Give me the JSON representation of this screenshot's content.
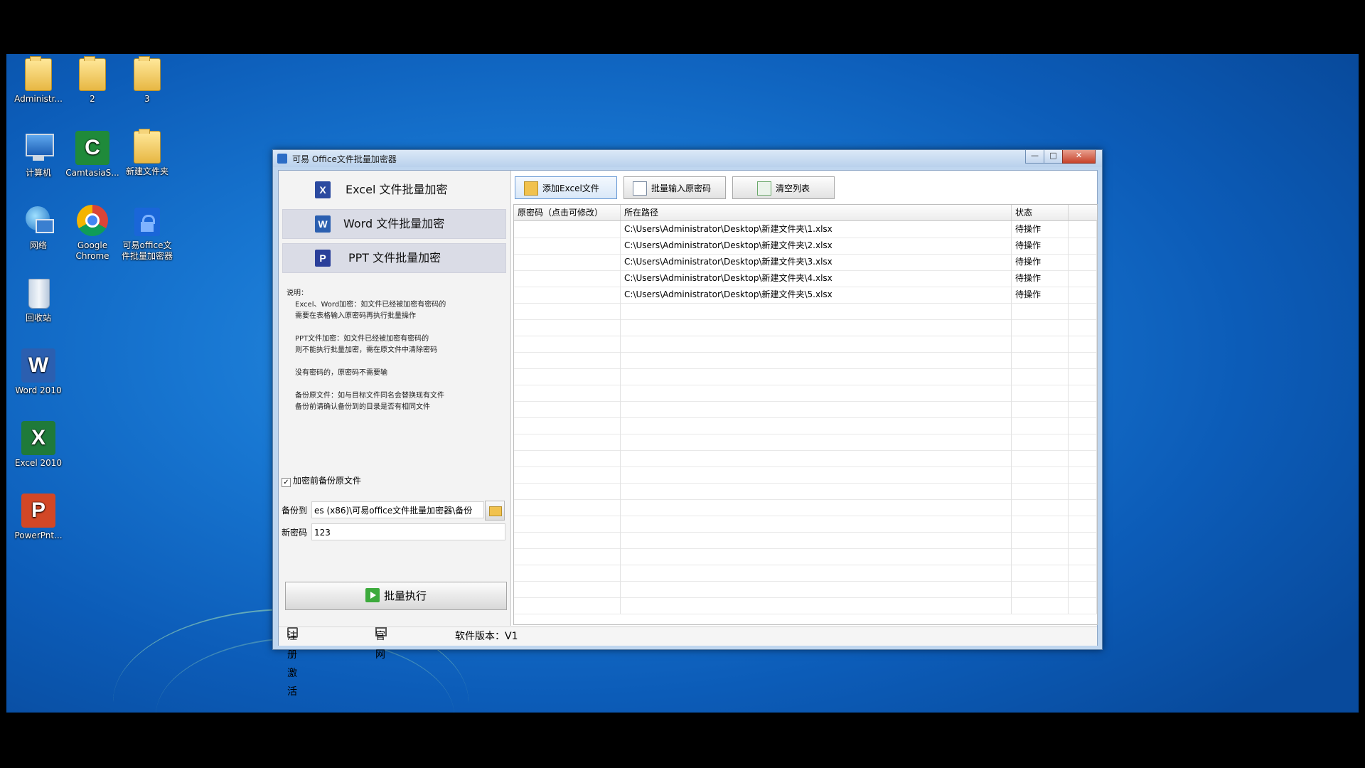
{
  "desktop": {
    "icons": [
      {
        "label": "Administr...",
        "icon": "user-folder-icon"
      },
      {
        "label": "2",
        "icon": "folder-icon"
      },
      {
        "label": "3",
        "icon": "folder-icon"
      },
      {
        "label": "计算机",
        "icon": "computer-icon"
      },
      {
        "label": "CamtasiaS...",
        "icon": "camtasia-icon"
      },
      {
        "label": "新建文件夹",
        "icon": "folder-icon"
      },
      {
        "label": "网络",
        "icon": "network-icon"
      },
      {
        "label": "Google Chrome",
        "icon": "chrome-icon"
      },
      {
        "label": "可易office文件批量加密器",
        "icon": "lock-app-icon"
      },
      {
        "label": "回收站",
        "icon": "recycle-bin-icon"
      },
      {
        "label": "Word 2010",
        "icon": "word-icon"
      },
      {
        "label": "Excel 2010",
        "icon": "excel-icon"
      },
      {
        "label": "PowerPnt...",
        "icon": "powerpoint-icon"
      }
    ]
  },
  "window": {
    "title": "可易 Office文件批量加密器",
    "controls": {
      "minimize": "—",
      "maximize": "□",
      "close": "✕"
    }
  },
  "left": {
    "nav": [
      {
        "label": "Excel 文件批量加密",
        "icon_letter": "X",
        "color": "#2b4aa0"
      },
      {
        "label": "Word 文件批量加密",
        "icon_letter": "W",
        "color": "#2b5fb0"
      },
      {
        "label": "PPT 文件批量加密",
        "icon_letter": "P",
        "color": "#2a3f9a"
      }
    ],
    "desc": {
      "heading": "说明：",
      "lines": [
        "Excel、Word加密：如文件已经被加密有密码的",
        "需要在表格输入原密码再执行批量操作",
        "",
        "PPT文件加密：如文件已经被加密有密码的",
        "则不能执行批量加密，需在原文件中清除密码",
        "",
        "没有密码的，原密码不需要输",
        "",
        "备份原文件：如与目标文件同名会替换现有文件",
        "备份前请确认备份到的目录是否有相同文件"
      ]
    },
    "backup_checkbox": {
      "label": "加密前备份原文件",
      "checked": "✓"
    },
    "backup_to": {
      "label": "备份到",
      "value": "es (x86)\\可易office文件批量加密器\\备份"
    },
    "new_password": {
      "label": "新密码",
      "value": "123"
    },
    "execute_label": "批量执行"
  },
  "toolbar": {
    "add_excel": "添加Excel文件",
    "batch_input": "批量输入原密码",
    "clear_list": "清空列表"
  },
  "table": {
    "headers": [
      "原密码（点击可修改）",
      "所在路径",
      "状态"
    ],
    "rows": [
      {
        "password": "",
        "path": "C:\\Users\\Administrator\\Desktop\\新建文件夹\\1.xlsx",
        "status": "待操作"
      },
      {
        "password": "",
        "path": "C:\\Users\\Administrator\\Desktop\\新建文件夹\\2.xlsx",
        "status": "待操作"
      },
      {
        "password": "",
        "path": "C:\\Users\\Administrator\\Desktop\\新建文件夹\\3.xlsx",
        "status": "待操作"
      },
      {
        "password": "",
        "path": "C:\\Users\\Administrator\\Desktop\\新建文件夹\\4.xlsx",
        "status": "待操作"
      },
      {
        "password": "",
        "path": "C:\\Users\\Administrator\\Desktop\\新建文件夹\\5.xlsx",
        "status": "待操作"
      }
    ]
  },
  "statusbar": {
    "register": "注册激活",
    "website": "官网",
    "version": "软件版本：V1"
  }
}
